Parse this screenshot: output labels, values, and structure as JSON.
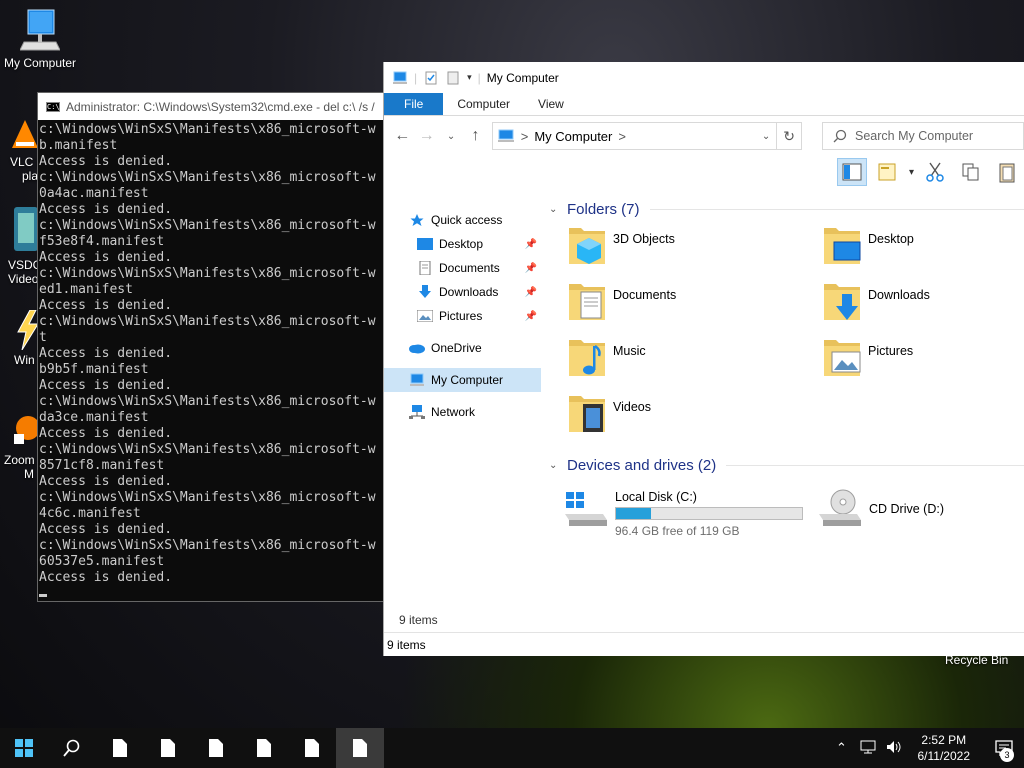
{
  "desktop": {
    "icons": {
      "my_computer": "My Computer",
      "vlc_partial": [
        "VLC r",
        "pla"
      ],
      "vsdc_partial": [
        "VSDC",
        "Video"
      ],
      "win_partial": "Win",
      "zoom_partial": [
        "Zoom",
        "M"
      ],
      "recycle_bin": "Recycle Bin"
    }
  },
  "cmd": {
    "title": "Administrator: C:\\Windows\\System32\\cmd.exe - del  c:\\ /s /",
    "icon_text": "C:\\",
    "lines": [
      "c:\\Windows\\WinSxS\\Manifests\\x86_microsoft-w",
      "b.manifest",
      "Access is denied.",
      "c:\\Windows\\WinSxS\\Manifests\\x86_microsoft-w",
      "0a4ac.manifest",
      "Access is denied.",
      "c:\\Windows\\WinSxS\\Manifests\\x86_microsoft-w",
      "f53e8f4.manifest",
      "Access is denied.",
      "c:\\Windows\\WinSxS\\Manifests\\x86_microsoft-w",
      "ed1.manifest",
      "Access is denied.",
      "c:\\Windows\\WinSxS\\Manifests\\x86_microsoft-w",
      "t",
      "Access is denied.",
      "b9b5f.manifest",
      "Access is denied.",
      "c:\\Windows\\WinSxS\\Manifests\\x86_microsoft-w",
      "da3ce.manifest",
      "Access is denied.",
      "c:\\Windows\\WinSxS\\Manifests\\x86_microsoft-w",
      "8571cf8.manifest",
      "Access is denied.",
      "c:\\Windows\\WinSxS\\Manifests\\x86_microsoft-w",
      "4c6c.manifest",
      "Access is denied.",
      "c:\\Windows\\WinSxS\\Manifests\\x86_microsoft-w",
      "60537e5.manifest",
      "Access is denied."
    ]
  },
  "explorer": {
    "title": "My Computer",
    "tabs": {
      "file": "File",
      "computer": "Computer",
      "view": "View"
    },
    "address": {
      "location": "My Computer",
      "sep1": ">",
      "sep2": ">"
    },
    "search_placeholder": "Search My Computer",
    "nav": {
      "quick_access": "Quick access",
      "desktop": "Desktop",
      "documents": "Documents",
      "downloads": "Downloads",
      "pictures": "Pictures",
      "onedrive": "OneDrive",
      "my_computer": "My Computer",
      "network": "Network"
    },
    "folders_header": "Folders (7)",
    "folders": {
      "objects3d": "3D Objects",
      "desktop": "Desktop",
      "documents": "Documents",
      "downloads": "Downloads",
      "music": "Music",
      "pictures": "Pictures",
      "videos": "Videos"
    },
    "drives_header": "Devices and drives (2)",
    "drives": {
      "c_name": "Local Disk (C:)",
      "c_free": "96.4 GB free of 119 GB",
      "c_used_fraction": 0.19,
      "d_name": "CD Drive (D:)"
    },
    "status_items": "9 items",
    "status_bar": "9 items"
  },
  "taskbar": {
    "time": "2:52 PM",
    "date": "6/11/2022",
    "notifications": "3"
  },
  "colors": {
    "accent": "#1979ca",
    "selection": "#cce4f7",
    "drive_fill": "#26a0da",
    "group_header": "#1e3287"
  }
}
